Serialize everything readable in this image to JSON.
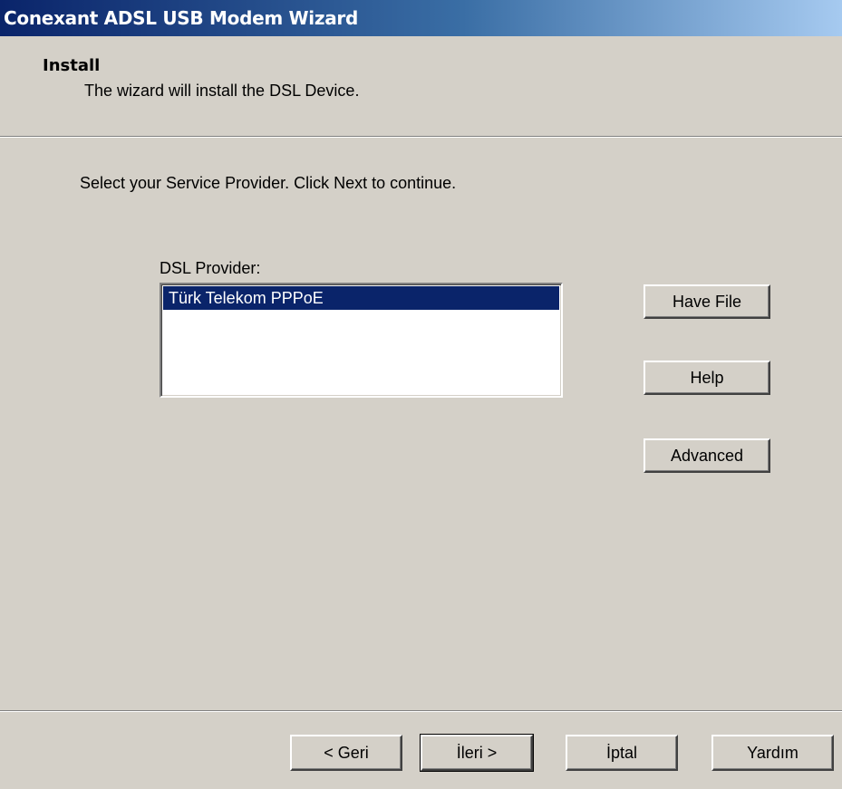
{
  "window": {
    "title": "Conexant ADSL USB Modem Wizard"
  },
  "header": {
    "title": "Install",
    "subtitle": "The wizard will install the DSL Device."
  },
  "main": {
    "instruction": "Select your Service Provider. Click Next to continue.",
    "listbox_label": "DSL Provider:",
    "providers": [
      {
        "label": "Türk Telekom PPPoE",
        "selected": true
      }
    ],
    "buttons": {
      "have_file": "Have File",
      "help": "Help",
      "advanced": "Advanced"
    }
  },
  "footer": {
    "back": "< Geri",
    "next": "İleri >",
    "cancel": "İptal",
    "help": "Yardım"
  },
  "colors": {
    "titlebar_start": "#0a246a",
    "titlebar_end": "#a6caf0",
    "dialog_bg": "#d4d0c8",
    "selection": "#0a246a"
  }
}
